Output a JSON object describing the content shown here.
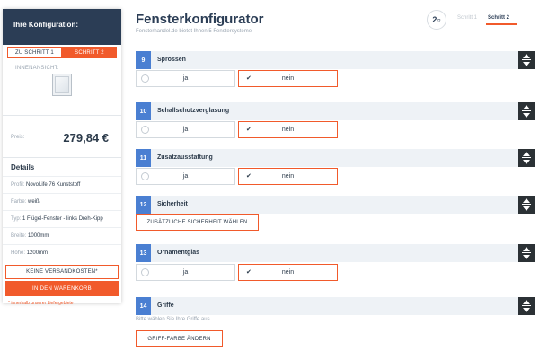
{
  "sidebar": {
    "heading": "Ihre Konfiguration:",
    "steps": [
      "ZU SCHRITT 1",
      "SCHRITT 2"
    ],
    "view_label": "INNENANSICHT:",
    "price_label": "Preis:",
    "price_value": "279,84 €",
    "details_title": "Details",
    "details": [
      {
        "key": "Profil:",
        "value": "NovoLife 76 Kunststoff"
      },
      {
        "key": "Farbe:",
        "value": "weiß"
      },
      {
        "key": "Typ:",
        "value": "1 Flügel-Fenster - links Dreh-Kipp"
      },
      {
        "key": "Breite:",
        "value": "1000mm"
      },
      {
        "key": "Höhe:",
        "value": "1200mm"
      }
    ],
    "shipping_button": "KEINE VERSANDKOSTEN*",
    "cart_button": "IN DEN WARENKORB",
    "footnote": "* innerhalb unserer Liefergebiete"
  },
  "header": {
    "title": "Fensterkonfigurator",
    "subtitle": "Fensterhandel.de bietet Ihnen 5 Fenstersysteme",
    "step_current": "2",
    "step_total": "/2",
    "tabs": [
      "Schritt 1",
      "Schritt 2"
    ]
  },
  "sections": [
    {
      "number": "9",
      "title": "Sprossen",
      "options": [
        "ja",
        "nein"
      ],
      "selected": "nein"
    },
    {
      "number": "10",
      "title": "Schallschutzverglasung",
      "options": [
        "ja",
        "nein"
      ],
      "selected": "nein"
    },
    {
      "number": "11",
      "title": "Zusatzausstattung",
      "options": [
        "ja",
        "nein"
      ],
      "selected": "nein"
    },
    {
      "number": "12",
      "title": "Sicherheit",
      "button": "ZUSÄTZLICHE SICHERHEIT WÄHLEN"
    },
    {
      "number": "13",
      "title": "Ornamentglas",
      "options": [
        "ja",
        "nein"
      ],
      "selected": "nein"
    },
    {
      "number": "14",
      "title": "Griffe",
      "hint": "Bitte wählen Sie Ihre Griffe aus.",
      "button": "GRIFF-FARBE ÄNDERN"
    }
  ],
  "colors": {
    "accent": "#f15a2b",
    "navy": "#2b3d55",
    "number_badge": "#4a7fd2"
  },
  "icons": {
    "toggle": "up-down-arrows-icon",
    "check": "checkmark-icon",
    "radio": "radio-empty-icon",
    "preview": "window-preview-icon"
  }
}
